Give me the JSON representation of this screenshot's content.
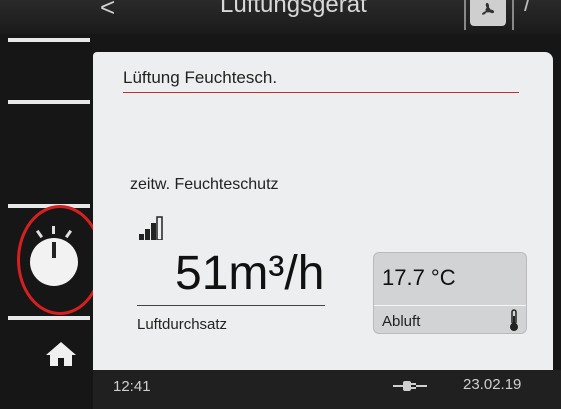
{
  "header": {
    "back_glyph": "<",
    "title": "Lüftungsgerät"
  },
  "screen": {
    "title": "Lüftung Feuchtesch.",
    "mode": "zeitw. Feuchteschutz",
    "airflow_value": "51m³/h",
    "airflow_label": "Luftdurchsatz",
    "temperature": "17.7 °C",
    "temperature_source": "Abluft"
  },
  "status": {
    "time": "12:41",
    "date": "23.02.19"
  },
  "colors": {
    "highlight_ring": "#d62020",
    "panel_bg": "#eceeef",
    "accent_line": "#b33333"
  }
}
